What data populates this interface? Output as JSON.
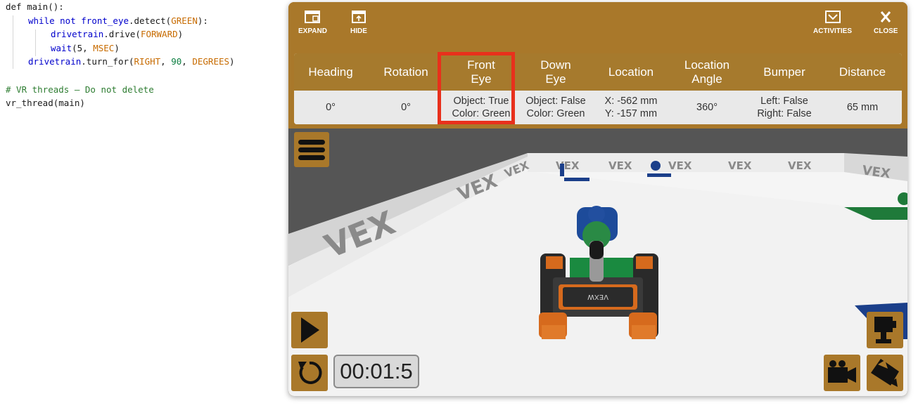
{
  "code": {
    "lines": [
      {
        "indent": 0,
        "tokens": [
          {
            "t": "def ",
            "c": "fn"
          },
          {
            "t": "main():",
            "c": "fn"
          }
        ]
      },
      {
        "indent": 1,
        "tokens": [
          {
            "t": "while not ",
            "c": "kw"
          },
          {
            "t": "front_eye",
            "c": "kw"
          },
          {
            "t": ".detect(",
            "c": "fn"
          },
          {
            "t": "GREEN",
            "c": "const"
          },
          {
            "t": "):",
            "c": "fn"
          }
        ]
      },
      {
        "indent": 2,
        "tokens": [
          {
            "t": "drivetrain",
            "c": "kw"
          },
          {
            "t": ".drive(",
            "c": "fn"
          },
          {
            "t": "FORWARD",
            "c": "const"
          },
          {
            "t": ")",
            "c": "fn"
          }
        ]
      },
      {
        "indent": 2,
        "tokens": [
          {
            "t": "wait",
            "c": "kw"
          },
          {
            "t": "(5, ",
            "c": "fn"
          },
          {
            "t": "MSEC",
            "c": "const"
          },
          {
            "t": ")",
            "c": "fn"
          }
        ]
      },
      {
        "indent": 1,
        "tokens": [
          {
            "t": "drivetrain",
            "c": "kw"
          },
          {
            "t": ".turn_for(",
            "c": "fn"
          },
          {
            "t": "RIGHT",
            "c": "const"
          },
          {
            "t": ", ",
            "c": "fn"
          },
          {
            "t": "90",
            "c": "num"
          },
          {
            "t": ", ",
            "c": "fn"
          },
          {
            "t": "DEGREES",
            "c": "const"
          },
          {
            "t": ")",
            "c": "fn"
          }
        ]
      },
      {
        "indent": 0,
        "tokens": []
      },
      {
        "indent": 0,
        "tokens": [
          {
            "t": "# VR threads — Do not delete",
            "c": "cmt"
          }
        ]
      },
      {
        "indent": 0,
        "tokens": [
          {
            "t": "vr_thread",
            "c": "fn"
          },
          {
            "t": "(main)",
            "c": "fn"
          }
        ]
      }
    ]
  },
  "toolbar": {
    "expand": "EXPAND",
    "hide": "HIDE",
    "activities": "ACTIVITIES",
    "close": "CLOSE"
  },
  "sensors": {
    "headers": [
      "Heading",
      "Rotation",
      "Front\nEye",
      "Down\nEye",
      "Location",
      "Location\nAngle",
      "Bumper",
      "Distance"
    ],
    "values": [
      "0°",
      "0°",
      "Object: True\nColor: Green",
      "Object: False\nColor: Green",
      "X: -562 mm\nY: -157 mm",
      "360°",
      "Left: False\nRight: False",
      "65 mm"
    ]
  },
  "timer": "00:01:5",
  "scene": {
    "wall_logo": "VEX",
    "robot_plate": "VEXW"
  },
  "colors": {
    "brand_gold": "#a9782a",
    "highlight": "#e8301c"
  }
}
